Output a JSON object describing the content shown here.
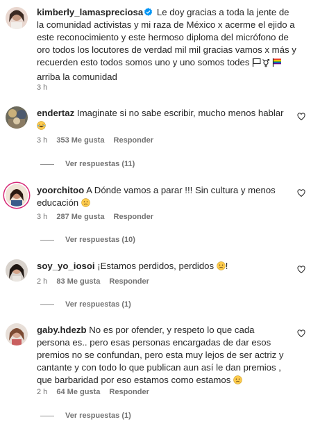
{
  "caption": {
    "username": "kimberly_lamaspreciosa",
    "text": "Le doy gracias a toda la jente de la comunidad activistas y mi raza de México x acerme el ejido a este reconocimiento y este hermoso diploma del micrófono de oro todos los locutores de verdad mil mil gracias vamos x más y recuerden esto todos somos uno y uno somos todes",
    "text_end": "arriba la comunidad",
    "time": "3 h",
    "verified_icon": "verified-badge-icon",
    "flag_icons": [
      "white-flag-icon",
      "transgender-symbol-icon",
      "rainbow-flag-icon"
    ]
  },
  "comments": [
    {
      "username": "endertaz",
      "text": "Imaginate si no sabe escribir, mucho menos hablar",
      "emoji": "laughing-face-icon",
      "time": "3 h",
      "likes": "353 Me gusta",
      "reply": "Responder",
      "view_replies": "Ver respuestas (11)"
    },
    {
      "username": "yoorchitoo",
      "text": "A Dónde vamos a parar !!! Sin cultura y menos educación",
      "emoji": "sad-face-icon",
      "time": "3 h",
      "likes": "287 Me gusta",
      "reply": "Responder",
      "view_replies": "Ver respuestas (10)"
    },
    {
      "username": "soy_yo_iosoi",
      "text": "¡Estamos perdidos, perdidos",
      "text_end": "!",
      "emoji": "sad-face-icon",
      "time": "2 h",
      "likes": "83 Me gusta",
      "reply": "Responder",
      "view_replies": "Ver respuestas (1)"
    },
    {
      "username": "gaby.hdezb",
      "text": "No es por ofender, y respeto lo que cada persona es.. pero esas personas encargadas de dar esos premios no se confundan, pero esta muy lejos de ser actriz y cantante y con todo lo que publican aun así le dan premios , que barbaridad por eso estamos como estamos",
      "emoji": "sad-face-icon",
      "time": "2 h",
      "likes": "64 Me gusta",
      "reply": "Responder",
      "view_replies": "Ver respuestas (1)"
    }
  ],
  "colors": {
    "text": "#262626",
    "muted": "#737373",
    "verified": "#0095f6"
  }
}
